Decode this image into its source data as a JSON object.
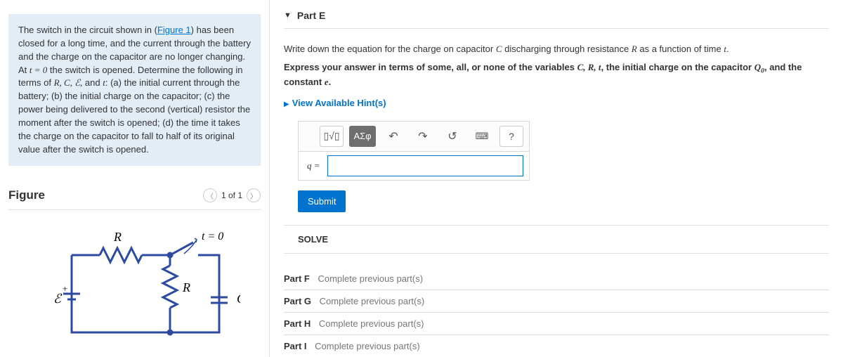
{
  "problem": {
    "text_before_link": "The switch in the circuit shown in (",
    "link": "Figure 1",
    "text_after_link": ") has been closed for a long time, and the current through the battery and the charge on the capacitor are no longer changing. At ",
    "t0": "t = 0",
    "text2": " the switch is opened. Determine the following in terms of ",
    "vars": "R, C, ℰ,",
    "and": " and ",
    "tvar": "t",
    "text3": ": (a) the initial current through the battery; (b) the initial charge on the capacitor; (c) the power being delivered to the second (vertical) resistor the moment after the switch is opened; (d) the time it takes the charge on the capacitor to fall to half of its original value after the switch is opened."
  },
  "figure": {
    "title": "Figure",
    "pager": "1 of 1",
    "labels": {
      "R1": "R",
      "R2": "R",
      "C": "C",
      "E": "ℰ",
      "t0": "t = 0",
      "plus": "+"
    }
  },
  "partE": {
    "title": "Part E",
    "instr1": "Write down the equation for the charge on capacitor ",
    "C": "C",
    "instr2": " discharging through resistance ",
    "R": "R",
    "instr3": " as a function of time ",
    "t": "t",
    "instr4": ".",
    "bold1": "Express your answer in terms of some, all, or none of the variables ",
    "boldvars": "C, R, t",
    "bold2": ", the initial charge on the capacitor ",
    "Q0": "Q",
    "Q0sub": "0",
    "bold3": ", and the constant ",
    "e": "e",
    "bold4": ".",
    "hints": "View Available Hint(s)",
    "toolbar": {
      "templates": "▯√▯",
      "greek": "ΑΣφ",
      "undo": "↶",
      "redo": "↷",
      "reset": "↺",
      "keyboard": "⌨",
      "help": "?"
    },
    "lhs": "q =",
    "submit": "Submit"
  },
  "solve": "SOLVE",
  "locked": [
    {
      "title": "Part F",
      "msg": "Complete previous part(s)"
    },
    {
      "title": "Part G",
      "msg": "Complete previous part(s)"
    },
    {
      "title": "Part H",
      "msg": "Complete previous part(s)"
    },
    {
      "title": "Part I",
      "msg": "Complete previous part(s)"
    }
  ]
}
